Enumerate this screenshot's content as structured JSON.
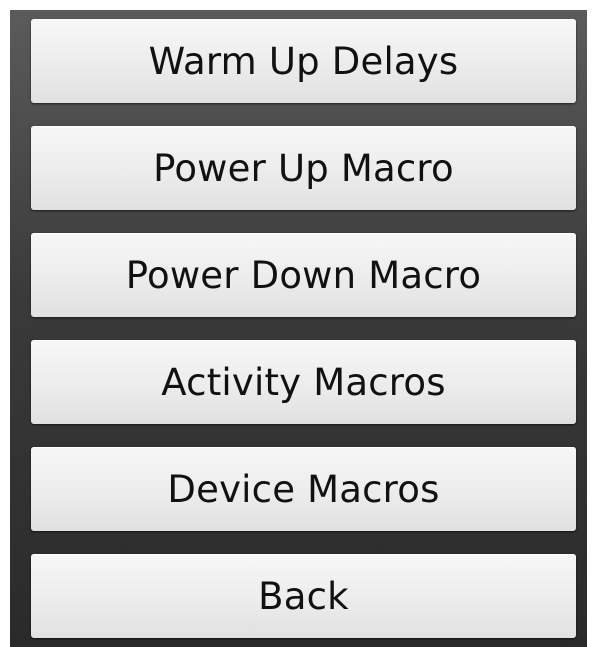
{
  "menu": {
    "items": [
      {
        "label": "Warm Up Delays"
      },
      {
        "label": "Power Up Macro"
      },
      {
        "label": "Power Down Macro"
      },
      {
        "label": "Activity Macros"
      },
      {
        "label": "Device Macros"
      },
      {
        "label": "Back"
      }
    ]
  },
  "colors": {
    "background_top": "#5b5b5b",
    "background_bottom": "#2a2a2a",
    "button_face": "#ececec",
    "label_text": "#111111"
  }
}
